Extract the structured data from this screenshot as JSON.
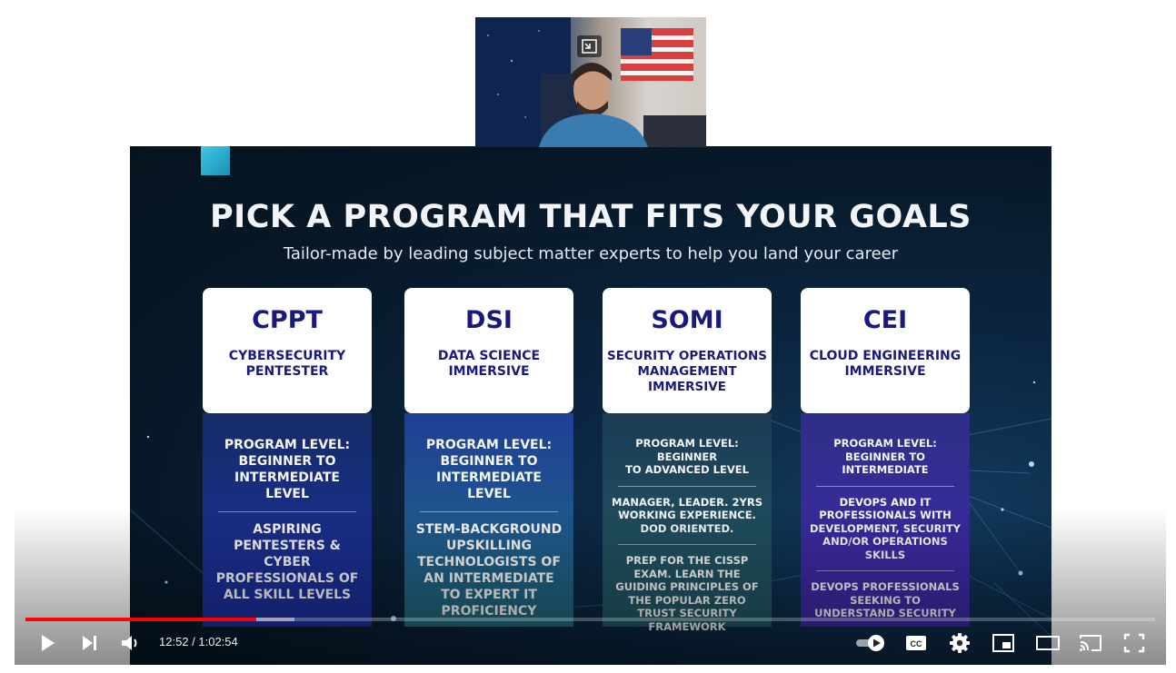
{
  "slide": {
    "title": "PICK A PROGRAM THAT FITS YOUR GOALS",
    "subtitle": "Tailor-made by leading subject matter experts to help you land your career",
    "programs": [
      {
        "code": "CPPT",
        "name": [
          "CYBERSECURITY",
          "PENTESTER"
        ],
        "level": [
          "PROGRAM LEVEL:",
          "BEGINNER TO",
          "INTERMEDIATE",
          "LEVEL"
        ],
        "sections": [
          [
            "ASPIRING",
            "PENTESTERS &",
            "CYBER",
            "PROFESSIONALS OF",
            "ALL SKILL LEVELS"
          ]
        ]
      },
      {
        "code": "DSI",
        "name": [
          "DATA SCIENCE",
          "IMMERSIVE"
        ],
        "level": [
          "PROGRAM LEVEL:",
          "BEGINNER TO",
          "INTERMEDIATE",
          "LEVEL"
        ],
        "sections": [
          [
            "STEM-BACKGROUND",
            "UPSKILLING",
            "TECHNOLOGISTS OF",
            "AN INTERMEDIATE",
            "TO EXPERT IT",
            "PROFICIENCY"
          ]
        ]
      },
      {
        "code": "SOMI",
        "name": [
          "SECURITY OPERATIONS",
          "MANAGEMENT",
          "IMMERSIVE"
        ],
        "level": [
          "PROGRAM LEVEL:",
          "BEGINNER",
          "TO ADVANCED LEVEL"
        ],
        "sections": [
          [
            "MANAGER, LEADER. 2YRS",
            "WORKING EXPERIENCE.",
            "DOD ORIENTED."
          ],
          [
            "PREP FOR THE CISSP",
            "EXAM. LEARN THE",
            "GUIDING PRINCIPLES OF",
            "THE POPULAR ZERO",
            "TRUST SECURITY",
            "FRAMEWORK"
          ]
        ]
      },
      {
        "code": "CEI",
        "name": [
          "CLOUD ENGINEERING",
          "IMMERSIVE"
        ],
        "level": [
          "PROGRAM LEVEL:",
          "BEGINNER TO",
          "INTERMEDIATE"
        ],
        "sections": [
          [
            "DEVOPS AND IT",
            "PROFESSIONALS WITH",
            "DEVELOPMENT, SECURITY",
            "AND/OR OPERATIONS",
            "SKILLS"
          ],
          [
            "DEVOPS PROFESSIONALS",
            "SEEKING TO",
            "UNDERSTAND SECURITY"
          ]
        ]
      }
    ]
  },
  "player": {
    "time_display": "12:52 / 1:02:54",
    "progress_played_fraction": 0.204,
    "progress_buffered_fraction": 0.238,
    "colors": {
      "played": "#ff0000",
      "controls": "#ffffff"
    },
    "controls": [
      "play-icon",
      "next-icon",
      "volume-icon",
      "autoplay-toggle-icon",
      "subtitles-icon",
      "settings-icon",
      "miniplayer-icon",
      "theater-mode-icon",
      "cast-icon",
      "fullscreen-icon"
    ],
    "captions_label": "CC"
  }
}
